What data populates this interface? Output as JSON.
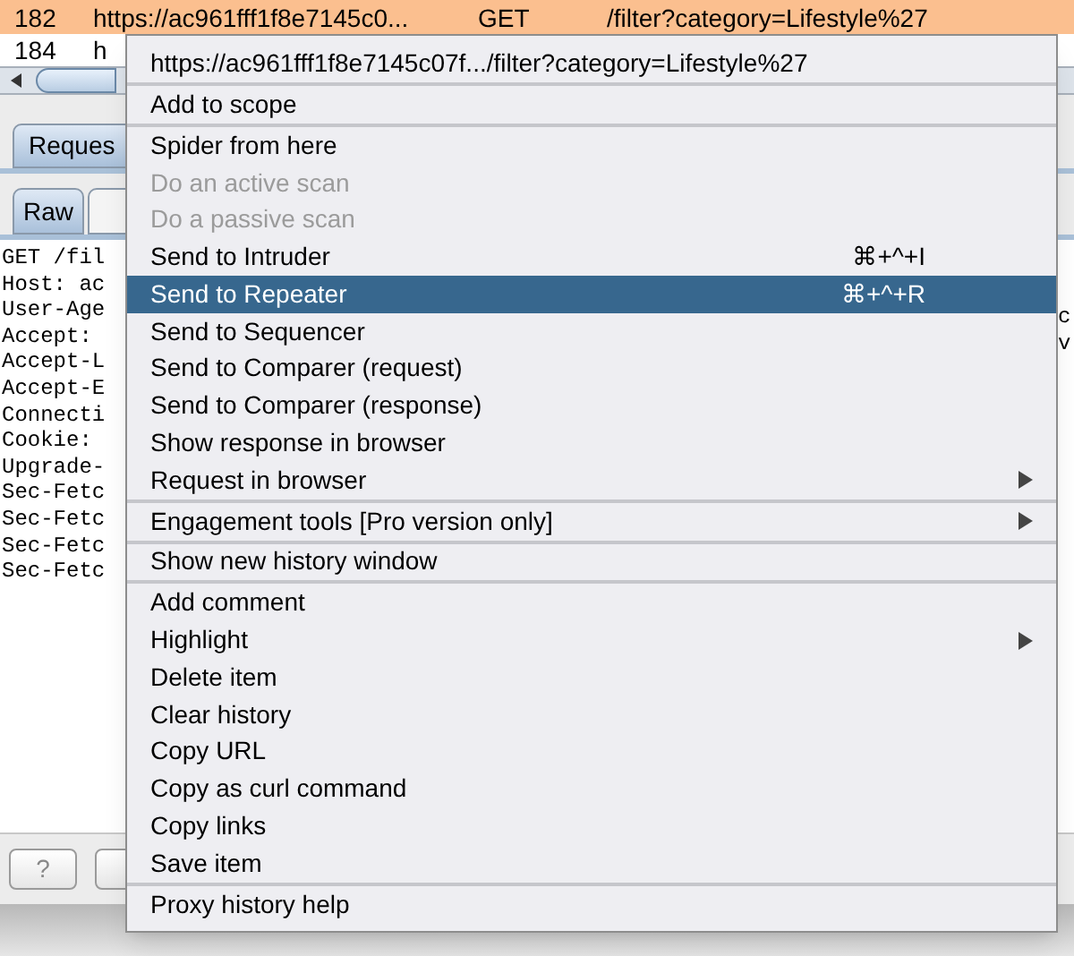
{
  "table": {
    "rows": [
      {
        "cells": [
          "182",
          "https://ac961fff1f8e7145c0...",
          "GET",
          "/filter?category=Lifestyle%27"
        ],
        "selected": true
      },
      {
        "cells": [
          "184",
          "h"
        ],
        "selected": false
      }
    ]
  },
  "tabs": [
    {
      "label": "Reques",
      "selected": true
    }
  ],
  "subtabs": [
    {
      "label": "Raw",
      "selected": true
    },
    {
      "selected": false
    }
  ],
  "request_lines": [
    {
      "left": "GET /fil"
    },
    {
      "left": "Host: ac"
    },
    {
      "left": "User-Age",
      "right": "c"
    },
    {
      "left": "Accept:",
      "right": "v"
    },
    {
      "left": "Accept-L"
    },
    {
      "left": "Accept-E"
    },
    {
      "left": "Connecti"
    },
    {
      "left": "Cookie:"
    },
    {
      "left": "Upgrade-"
    },
    {
      "left": "Sec-Fetc"
    },
    {
      "left": "Sec-Fetc"
    },
    {
      "left": "Sec-Fetc"
    },
    {
      "left": "Sec-Fetc"
    }
  ],
  "buttons": [
    {
      "kind": "help",
      "label": "?"
    },
    {
      "kind": "blank"
    }
  ],
  "context_menu": {
    "items": [
      {
        "kind": "header",
        "label": "https://ac961fff1f8e7145c07f.../filter?category=Lifestyle%27"
      },
      {
        "kind": "separator"
      },
      {
        "kind": "item",
        "label": "Add to scope",
        "disabled": false,
        "selected": false,
        "has_submenu": false
      },
      {
        "kind": "separator"
      },
      {
        "kind": "item",
        "label": "Spider from here",
        "disabled": false,
        "selected": false,
        "has_submenu": false
      },
      {
        "kind": "item",
        "label": "Do an active scan",
        "disabled": true,
        "selected": false,
        "has_submenu": false
      },
      {
        "kind": "item",
        "label": "Do a passive scan",
        "disabled": true,
        "selected": false,
        "has_submenu": false
      },
      {
        "kind": "item",
        "label": "Send to Intruder",
        "shortcut": "⌘+^+I",
        "disabled": false,
        "selected": false,
        "has_submenu": false
      },
      {
        "kind": "item",
        "label": "Send to Repeater",
        "shortcut": "⌘+^+R",
        "disabled": false,
        "selected": true,
        "has_submenu": false
      },
      {
        "kind": "item",
        "label": "Send to Sequencer",
        "disabled": false,
        "selected": false,
        "has_submenu": false
      },
      {
        "kind": "item",
        "label": "Send to Comparer (request)",
        "disabled": false,
        "selected": false,
        "has_submenu": false
      },
      {
        "kind": "item",
        "label": "Send to Comparer (response)",
        "disabled": false,
        "selected": false,
        "has_submenu": false
      },
      {
        "kind": "item",
        "label": "Show response in browser",
        "disabled": false,
        "selected": false,
        "has_submenu": false
      },
      {
        "kind": "item",
        "label": "Request in browser",
        "disabled": false,
        "selected": false,
        "has_submenu": true
      },
      {
        "kind": "separator"
      },
      {
        "kind": "item",
        "label": "Engagement tools [Pro version only]",
        "disabled": false,
        "selected": false,
        "has_submenu": true
      },
      {
        "kind": "separator"
      },
      {
        "kind": "item",
        "label": "Show new history window",
        "disabled": false,
        "selected": false,
        "has_submenu": false
      },
      {
        "kind": "separator"
      },
      {
        "kind": "item",
        "label": "Add comment",
        "disabled": false,
        "selected": false,
        "has_submenu": false
      },
      {
        "kind": "item",
        "label": "Highlight",
        "disabled": false,
        "selected": false,
        "has_submenu": true
      },
      {
        "kind": "item",
        "label": "Delete item",
        "disabled": false,
        "selected": false,
        "has_submenu": false
      },
      {
        "kind": "item",
        "label": "Clear history",
        "disabled": false,
        "selected": false,
        "has_submenu": false
      },
      {
        "kind": "item",
        "label": "Copy URL",
        "disabled": false,
        "selected": false,
        "has_submenu": false
      },
      {
        "kind": "item",
        "label": "Copy as curl command",
        "disabled": false,
        "selected": false,
        "has_submenu": false
      },
      {
        "kind": "item",
        "label": "Copy links",
        "disabled": false,
        "selected": false,
        "has_submenu": false
      },
      {
        "kind": "item",
        "label": "Save item",
        "disabled": false,
        "selected": false,
        "has_submenu": false
      },
      {
        "kind": "separator"
      },
      {
        "kind": "item",
        "label": "Proxy history help",
        "disabled": false,
        "selected": false,
        "has_submenu": false
      }
    ]
  }
}
